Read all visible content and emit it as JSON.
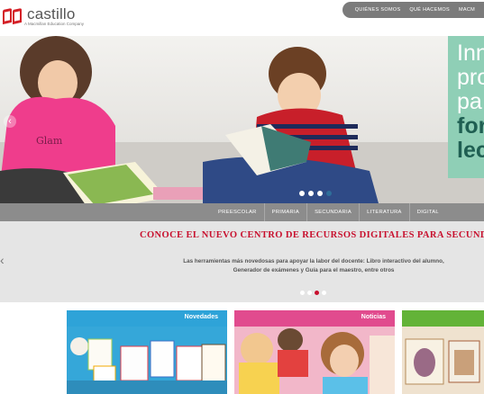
{
  "header": {
    "logo_name": "castillo",
    "logo_tagline": "A Macmillan Education Company",
    "nav": [
      "QUIÉNES SOMOS",
      "QUÉ HACEMOS",
      "MACM"
    ]
  },
  "hero": {
    "panel_words": [
      "Inn",
      "pro",
      "pa",
      "for",
      "lec"
    ],
    "slide_dots": 4,
    "active_dot": 3
  },
  "categories": [
    "PREESCOLAR",
    "PRIMARIA",
    "SECUNDARIA",
    "LITERATURA",
    "DIGITAL"
  ],
  "banner": {
    "title": "CONOCE EL NUEVO CENTRO DE RECURSOS DIGITALES PARA SECUNDARIA",
    "text": "Las herramientas más novedosas para apoyar la labor del docente: Libro interactivo del alumno, Generador de exámenes y Guía para el maestro, entre otros",
    "slide_dots": 4,
    "active_dot": 2
  },
  "cards": [
    {
      "label": "Novedades"
    },
    {
      "label": "Noticias"
    },
    {
      "label": ""
    }
  ],
  "colors": {
    "brand_red": "#d42027",
    "nav_gray": "#7b7b7b",
    "banner_title_red": "#c8102e",
    "novedades_blue": "#2ea3d8",
    "noticias_pink": "#e14b8e",
    "third_green": "#63b338"
  }
}
